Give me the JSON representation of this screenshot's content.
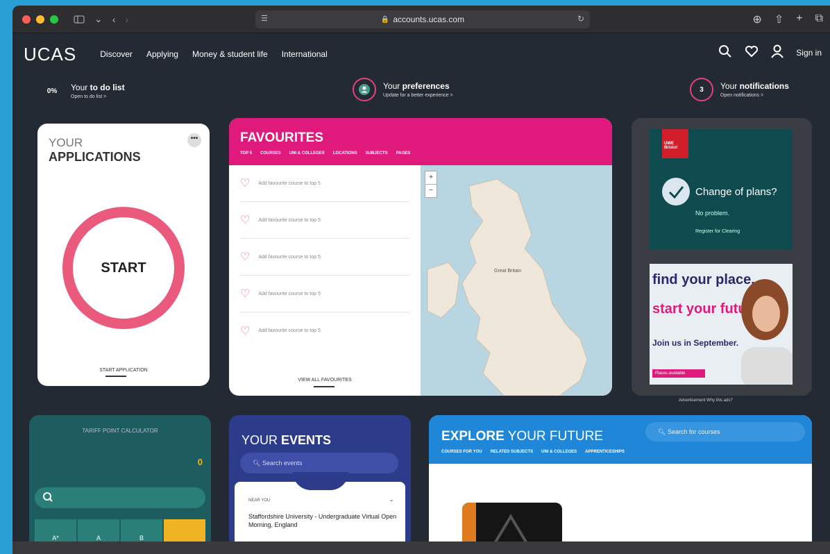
{
  "browser": {
    "url": "accounts.ucas.com"
  },
  "site": {
    "logo": "UCAS",
    "nav": [
      "Discover",
      "Applying",
      "Money & student life",
      "International"
    ],
    "sign_in": "Sign in"
  },
  "status": {
    "todo": {
      "percent": "0%",
      "prefix": "Your ",
      "bold": "to do list",
      "sub": "Open to do list  >"
    },
    "preferences": {
      "prefix": "Your ",
      "bold": "preferences",
      "sub": "Update for a better experience  >"
    },
    "notifications": {
      "count": "3",
      "prefix": "Your ",
      "bold": "notifications",
      "sub": "Open notifications  >"
    }
  },
  "applications": {
    "title_light": "YOUR",
    "title_bold": "APPLICATIONS",
    "menu": "•••",
    "start": "START",
    "link": "START APPLICATION"
  },
  "favourites": {
    "title": "FAVOURITES",
    "tabs": [
      "TOP 5",
      "COURSES",
      "UNI & COLLEGES",
      "LOCATIONS",
      "SUBJECTS",
      "PAGES"
    ],
    "items": [
      "Add favourite course to top 5",
      "Add favourite course to top 5",
      "Add favourite course to top 5",
      "Add favourite course to top 5",
      "Add favourite course to top 5"
    ],
    "view_all": "VIEW ALL FAVOURITES",
    "map": {
      "zoom_in": "+",
      "zoom_out": "−",
      "label": "Great Britain"
    }
  },
  "advert": {
    "ad1": {
      "brand": "UWE Bristol",
      "headline": "Change of plans?",
      "sub": "No problem.",
      "cta": "Register for Clearing"
    },
    "ad2": {
      "line1": "find your place.",
      "line2": "start your future.",
      "line3": "Join us in September.",
      "cta": "Places available"
    },
    "label": "Advertisement  Why this ads?"
  },
  "tariff": {
    "title": "TARIFF POINT CALCULATOR",
    "total": "0",
    "keys": [
      "A*",
      "A",
      "B",
      ""
    ]
  },
  "events": {
    "title_light": "YOUR ",
    "title_bold": "EVENTS",
    "search": "Search events",
    "near_you": "NEAR YOU",
    "event": "Staffordshire University - Undergraduate Virtual Open Morning, England"
  },
  "explore": {
    "title_bold": "EXPLORE",
    "title_light": " YOUR FUTURE",
    "search": "Search for courses",
    "tabs": [
      "COURSES FOR YOU",
      "RELATED SUBJECTS",
      "UNI & COLLEGES",
      "APPRENTICESHIPS"
    ]
  }
}
